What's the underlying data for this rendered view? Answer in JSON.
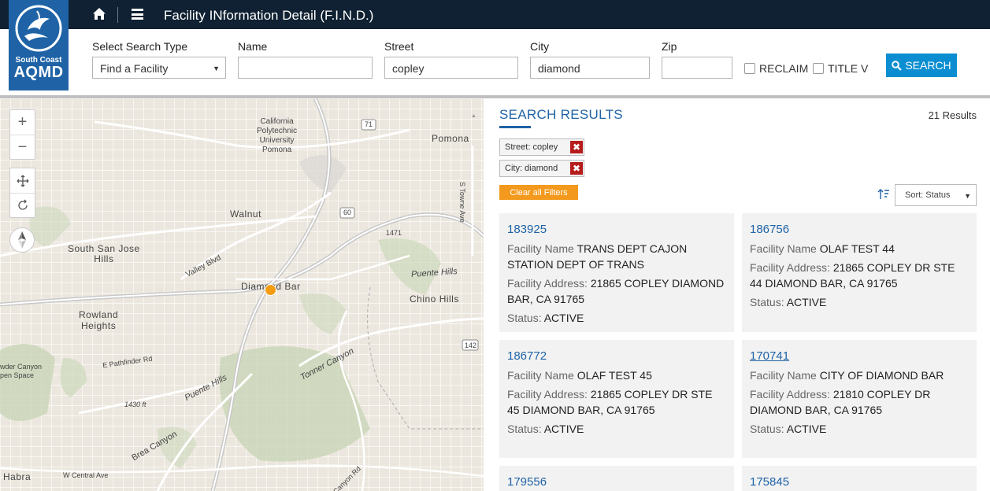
{
  "brand": {
    "line1": "South Coast",
    "line2": "AQMD"
  },
  "header": {
    "title": "Facility INformation Detail (F.I.N.D.)"
  },
  "search": {
    "type_label": "Select Search Type",
    "type_value": "Find a Facility",
    "name_label": "Name",
    "name_value": "",
    "street_label": "Street",
    "street_value": "copley",
    "city_label": "City",
    "city_value": "diamond",
    "zip_label": "Zip",
    "zip_value": "",
    "reclaim_label": "RECLAIM",
    "titlev_label": "TITLE V",
    "button_label": "SEARCH"
  },
  "map": {
    "labels": {
      "cal_poly": [
        "California",
        "Polytechnic",
        "University",
        "Pomona"
      ],
      "pomona": "Pomona",
      "walnut": "Walnut",
      "south_san_jose": [
        "South San Jose",
        "Hills"
      ],
      "valley_blvd": "Valley Blvd",
      "diamond_bar": "Diamond Bar",
      "puente_hills_1": "Puente Hills",
      "chino_hills": "Chino Hills",
      "rowland": [
        "Rowland",
        "Heights"
      ],
      "pathfinder": "E Pathfinder Rd",
      "tonner": "Tonner Canyon",
      "powder": [
        "wder Canyon",
        "pen Space"
      ],
      "puente_hills_2": "Puente Hills",
      "elev1": "1430 ft",
      "elev2": "1471",
      "brea": "Brea Canyon",
      "habra": "Habra",
      "central": "W Central Ave",
      "towne": "S Towne Ave",
      "canyon_rd": "Canyon Rd",
      "r71": "71",
      "r60": "60",
      "r142": "142"
    }
  },
  "results": {
    "title": "SEARCH RESULTS",
    "count": "21 Results",
    "filters": [
      "Street: copley",
      "City: diamond"
    ],
    "clear_label": "Clear all Filters",
    "sort_label": "Sort: Status",
    "name_label": "Facility Name",
    "address_label": "Facility Address:",
    "status_label": "Status:",
    "cards": [
      {
        "id": "183925",
        "name": "TRANS DEPT CAJON STATION DEPT OF TRANS",
        "address": "21865 COPLEY DIAMOND BAR, CA 91765",
        "status": "ACTIVE"
      },
      {
        "id": "186756",
        "name": "OLAF TEST 44",
        "address": "21865 COPLEY DR STE 44 DIAMOND BAR, CA 91765",
        "status": "ACTIVE"
      },
      {
        "id": "186772",
        "name": "OLAF TEST 45",
        "address": "21865 COPLEY DR STE 45 DIAMOND BAR, CA 91765",
        "status": "ACTIVE"
      },
      {
        "id": "170741",
        "name": "CITY OF DIAMOND BAR",
        "address": "21810 COPLEY DR DIAMOND BAR, CA 91765",
        "status": "ACTIVE"
      },
      {
        "id": "179556"
      },
      {
        "id": "175845"
      }
    ]
  }
}
